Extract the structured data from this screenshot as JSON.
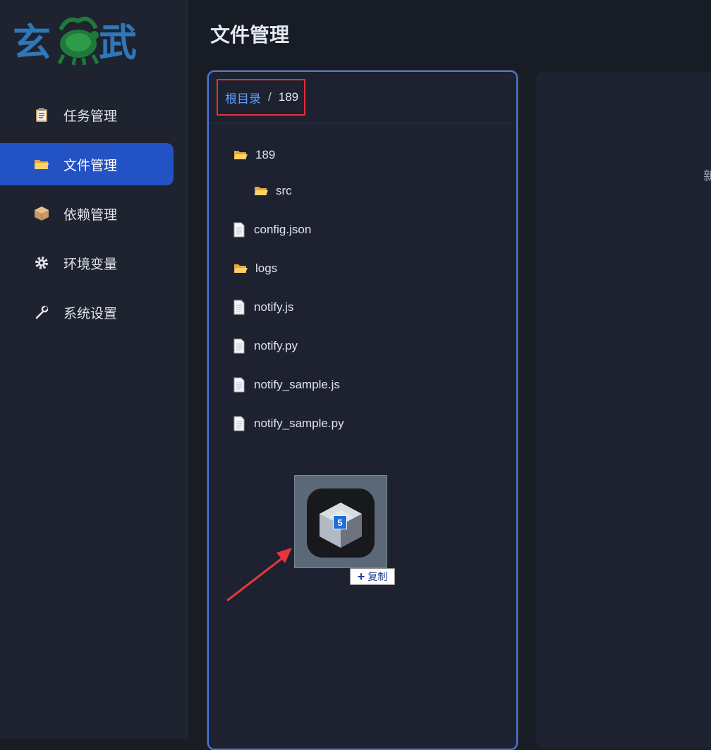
{
  "sidebar": {
    "logo": {
      "text": [
        "玄",
        "武"
      ]
    },
    "items": [
      {
        "label": "任务管理",
        "icon": "clipboard-icon",
        "active": false
      },
      {
        "label": "文件管理",
        "icon": "folder-icon",
        "active": true
      },
      {
        "label": "依赖管理",
        "icon": "package-icon",
        "active": false
      },
      {
        "label": "环境变量",
        "icon": "gear-icon",
        "active": false
      },
      {
        "label": "系统设置",
        "icon": "wrench-icon",
        "active": false
      }
    ]
  },
  "header": {
    "title": "文件管理"
  },
  "file_panel": {
    "breadcrumb": {
      "root": "根目录",
      "separator": "/",
      "current": "189"
    },
    "tree": [
      {
        "name": "189",
        "type": "folder",
        "open": true
      },
      {
        "name": "src",
        "type": "folder",
        "open": true
      },
      {
        "name": "config.json",
        "type": "file"
      },
      {
        "name": "logs",
        "type": "folder",
        "open": true
      },
      {
        "name": "notify.js",
        "type": "file"
      },
      {
        "name": "notify.py",
        "type": "file"
      },
      {
        "name": "notify_sample.js",
        "type": "file"
      },
      {
        "name": "notify_sample.py",
        "type": "file"
      }
    ]
  },
  "right_panel": {
    "hint": "新"
  },
  "drag": {
    "badge": "5",
    "copy_label": "复制"
  },
  "colors": {
    "accent": "#2352c4",
    "link": "#5c9dff",
    "highlight_box": "#e0333a",
    "arrow": "#e8363c"
  }
}
